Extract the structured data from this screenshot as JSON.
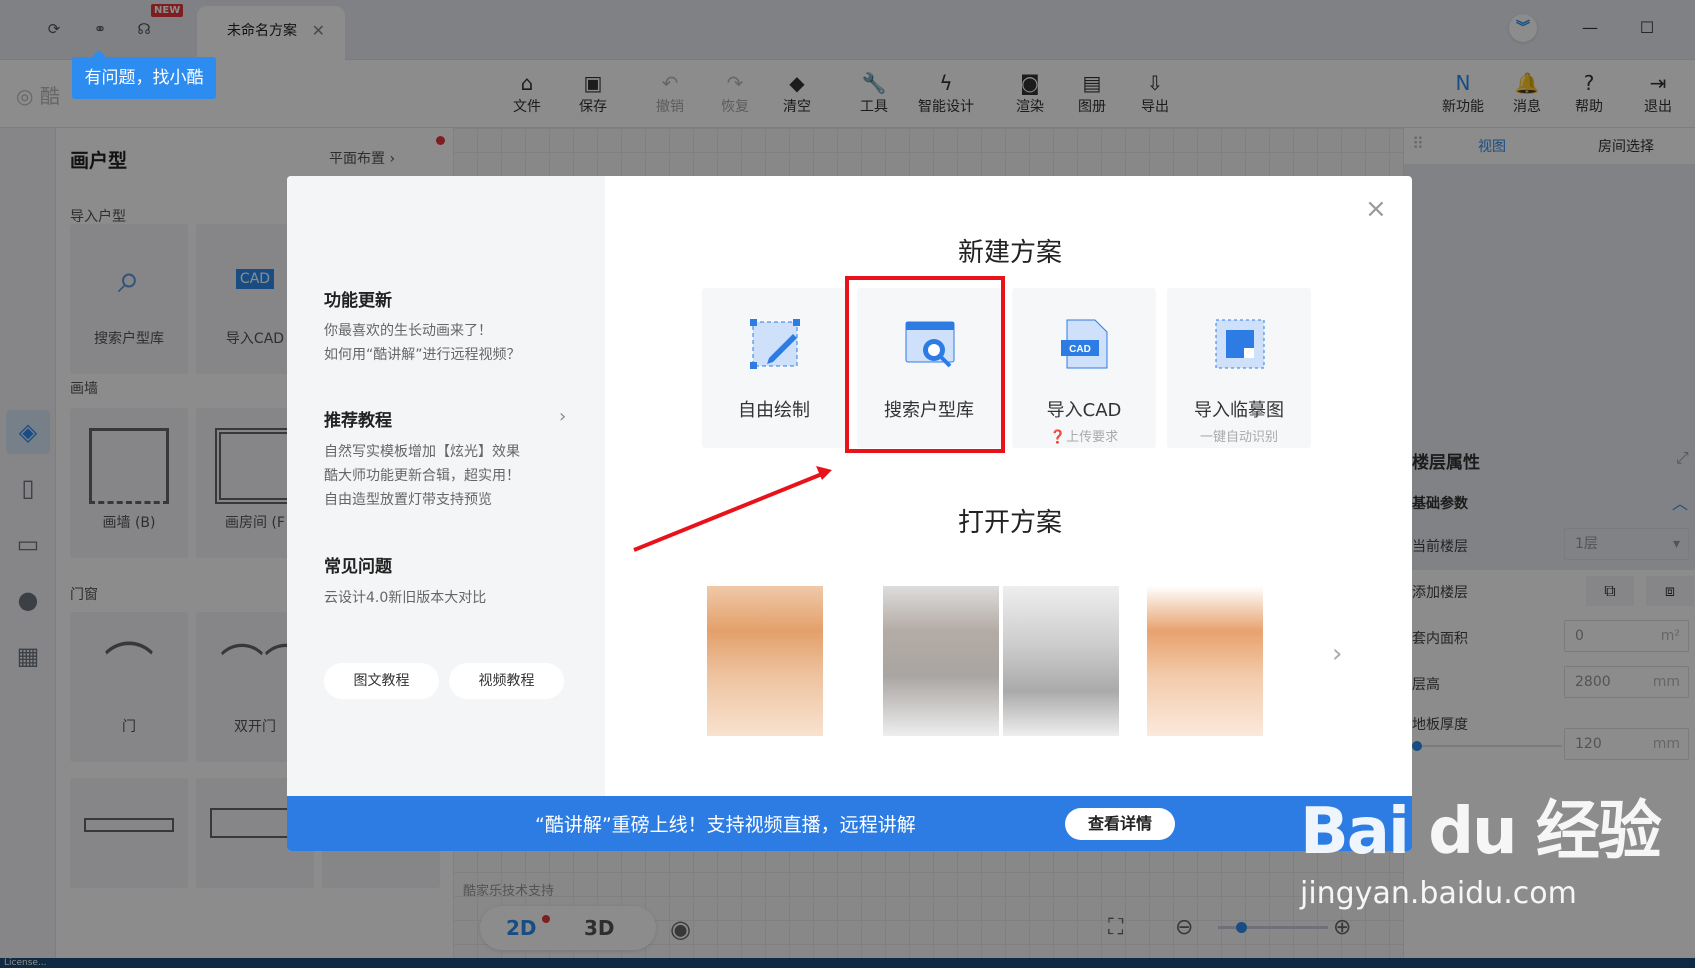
{
  "titlebar": {
    "tab_title": "未命名方案",
    "new_badge": "NEW",
    "help_tip": "有问题，找小酷",
    "icons": [
      "refresh-icon",
      "link-icon",
      "headset-icon"
    ]
  },
  "brand": {
    "logo_text": "酷"
  },
  "toolbar": {
    "items": [
      {
        "label": "文件",
        "icon": "file-icon",
        "enabled": true
      },
      {
        "label": "保存",
        "icon": "save-icon",
        "enabled": true
      },
      {
        "label": "撤销",
        "icon": "undo-icon",
        "enabled": false
      },
      {
        "label": "恢复",
        "icon": "redo-icon",
        "enabled": false
      },
      {
        "label": "清空",
        "icon": "eraser-icon",
        "enabled": true
      },
      {
        "label": "工具",
        "icon": "wrench-icon",
        "enabled": true
      },
      {
        "label": "智能设计",
        "icon": "lightning-icon",
        "enabled": true
      },
      {
        "label": "渲染",
        "icon": "camera-icon",
        "enabled": true
      },
      {
        "label": "图册",
        "icon": "album-icon",
        "enabled": true
      },
      {
        "label": "导出",
        "icon": "export-icon",
        "enabled": true
      }
    ],
    "right_items": [
      {
        "label": "新功能",
        "icon": "new-feature-icon"
      },
      {
        "label": "消息",
        "icon": "bell-icon"
      },
      {
        "label": "帮助",
        "icon": "help-icon"
      },
      {
        "label": "退出",
        "icon": "logout-icon"
      }
    ]
  },
  "left_panel": {
    "title": "画户型",
    "layout_link": "平面布置",
    "import_section": "导入户型",
    "import_cards": [
      "搜索户型库",
      "导入CAD"
    ],
    "wall_section": "画墙",
    "wall_cards": [
      "画墙 (B)",
      "画房间 (F"
    ],
    "door_section": "门窗",
    "door_cards": [
      "门",
      "双开门"
    ]
  },
  "right_panel": {
    "tabs": [
      "视图",
      "房间选择"
    ],
    "floor_title": "楼层属性",
    "basic_params": "基础参数",
    "rows": [
      {
        "label": "当前楼层",
        "value": "1层"
      },
      {
        "label": "添加楼层",
        "value": ""
      },
      {
        "label": "套内面积",
        "value": "0",
        "unit": "m²"
      },
      {
        "label": "层高",
        "value": "2800",
        "unit": "mm"
      },
      {
        "label": "地板厚度",
        "value": "120",
        "unit": "mm"
      }
    ]
  },
  "canvas": {
    "mode_2d": "2D",
    "mode_3d": "3D",
    "tech_support": "酷家乐技术支持"
  },
  "modal": {
    "left": {
      "sections": [
        {
          "heading": "功能更新",
          "lines": [
            "你最喜欢的生长动画来了！",
            "如何用“酷讲解”进行远程视频？"
          ]
        },
        {
          "heading": "推荐教程",
          "lines": [
            "自然写实模板增加【炫光】效果",
            "酷大师功能更新合辑，超实用！",
            "自由造型放置灯带支持预览"
          ]
        },
        {
          "heading": "常见问题",
          "lines": [
            "云设计4.0新旧版本大对比"
          ]
        }
      ],
      "buttons": [
        "图文教程",
        "视频教程"
      ]
    },
    "new_title": "新建方案",
    "options": [
      {
        "label": "自由绘制",
        "sub": ""
      },
      {
        "label": "搜索户型库",
        "sub": ""
      },
      {
        "label": "导入CAD",
        "sub": "上传要求"
      },
      {
        "label": "导入临摹图",
        "sub": "一键自动识别"
      }
    ],
    "open_title": "打开方案",
    "banner_text": "“酷讲解”重磅上线！支持视频直播，远程讲解",
    "banner_button": "查看详情",
    "colors": {
      "accent": "#2c7ce4",
      "highlight_box": "#e8121a",
      "arrow": "#e8121a"
    }
  },
  "watermark": {
    "brand": "Bai du 经验",
    "url": "jingyan.baidu.com"
  },
  "statusbar": {
    "text": "License..."
  }
}
